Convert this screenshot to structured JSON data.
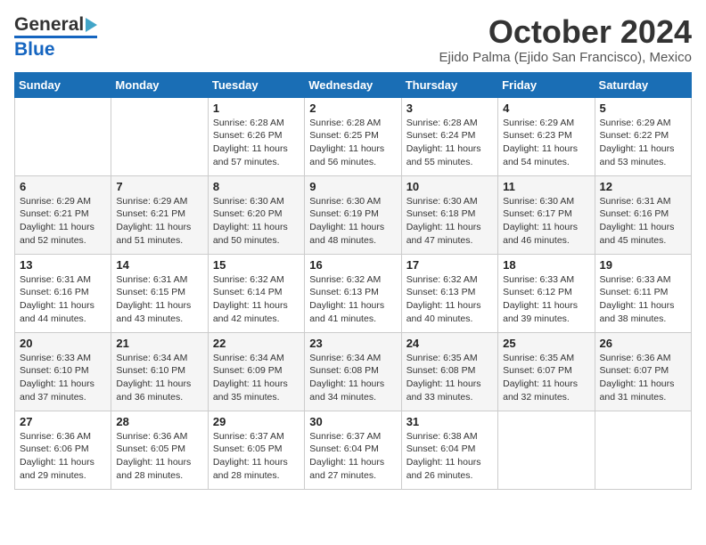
{
  "header": {
    "logo_general": "General",
    "logo_blue": "Blue",
    "month_title": "October 2024",
    "subtitle": "Ejido Palma (Ejido San Francisco), Mexico"
  },
  "days_of_week": [
    "Sunday",
    "Monday",
    "Tuesday",
    "Wednesday",
    "Thursday",
    "Friday",
    "Saturday"
  ],
  "weeks": [
    [
      {
        "num": "",
        "detail": ""
      },
      {
        "num": "",
        "detail": ""
      },
      {
        "num": "1",
        "detail": "Sunrise: 6:28 AM\nSunset: 6:26 PM\nDaylight: 11 hours and 57 minutes."
      },
      {
        "num": "2",
        "detail": "Sunrise: 6:28 AM\nSunset: 6:25 PM\nDaylight: 11 hours and 56 minutes."
      },
      {
        "num": "3",
        "detail": "Sunrise: 6:28 AM\nSunset: 6:24 PM\nDaylight: 11 hours and 55 minutes."
      },
      {
        "num": "4",
        "detail": "Sunrise: 6:29 AM\nSunset: 6:23 PM\nDaylight: 11 hours and 54 minutes."
      },
      {
        "num": "5",
        "detail": "Sunrise: 6:29 AM\nSunset: 6:22 PM\nDaylight: 11 hours and 53 minutes."
      }
    ],
    [
      {
        "num": "6",
        "detail": "Sunrise: 6:29 AM\nSunset: 6:21 PM\nDaylight: 11 hours and 52 minutes."
      },
      {
        "num": "7",
        "detail": "Sunrise: 6:29 AM\nSunset: 6:21 PM\nDaylight: 11 hours and 51 minutes."
      },
      {
        "num": "8",
        "detail": "Sunrise: 6:30 AM\nSunset: 6:20 PM\nDaylight: 11 hours and 50 minutes."
      },
      {
        "num": "9",
        "detail": "Sunrise: 6:30 AM\nSunset: 6:19 PM\nDaylight: 11 hours and 48 minutes."
      },
      {
        "num": "10",
        "detail": "Sunrise: 6:30 AM\nSunset: 6:18 PM\nDaylight: 11 hours and 47 minutes."
      },
      {
        "num": "11",
        "detail": "Sunrise: 6:30 AM\nSunset: 6:17 PM\nDaylight: 11 hours and 46 minutes."
      },
      {
        "num": "12",
        "detail": "Sunrise: 6:31 AM\nSunset: 6:16 PM\nDaylight: 11 hours and 45 minutes."
      }
    ],
    [
      {
        "num": "13",
        "detail": "Sunrise: 6:31 AM\nSunset: 6:16 PM\nDaylight: 11 hours and 44 minutes."
      },
      {
        "num": "14",
        "detail": "Sunrise: 6:31 AM\nSunset: 6:15 PM\nDaylight: 11 hours and 43 minutes."
      },
      {
        "num": "15",
        "detail": "Sunrise: 6:32 AM\nSunset: 6:14 PM\nDaylight: 11 hours and 42 minutes."
      },
      {
        "num": "16",
        "detail": "Sunrise: 6:32 AM\nSunset: 6:13 PM\nDaylight: 11 hours and 41 minutes."
      },
      {
        "num": "17",
        "detail": "Sunrise: 6:32 AM\nSunset: 6:13 PM\nDaylight: 11 hours and 40 minutes."
      },
      {
        "num": "18",
        "detail": "Sunrise: 6:33 AM\nSunset: 6:12 PM\nDaylight: 11 hours and 39 minutes."
      },
      {
        "num": "19",
        "detail": "Sunrise: 6:33 AM\nSunset: 6:11 PM\nDaylight: 11 hours and 38 minutes."
      }
    ],
    [
      {
        "num": "20",
        "detail": "Sunrise: 6:33 AM\nSunset: 6:10 PM\nDaylight: 11 hours and 37 minutes."
      },
      {
        "num": "21",
        "detail": "Sunrise: 6:34 AM\nSunset: 6:10 PM\nDaylight: 11 hours and 36 minutes."
      },
      {
        "num": "22",
        "detail": "Sunrise: 6:34 AM\nSunset: 6:09 PM\nDaylight: 11 hours and 35 minutes."
      },
      {
        "num": "23",
        "detail": "Sunrise: 6:34 AM\nSunset: 6:08 PM\nDaylight: 11 hours and 34 minutes."
      },
      {
        "num": "24",
        "detail": "Sunrise: 6:35 AM\nSunset: 6:08 PM\nDaylight: 11 hours and 33 minutes."
      },
      {
        "num": "25",
        "detail": "Sunrise: 6:35 AM\nSunset: 6:07 PM\nDaylight: 11 hours and 32 minutes."
      },
      {
        "num": "26",
        "detail": "Sunrise: 6:36 AM\nSunset: 6:07 PM\nDaylight: 11 hours and 31 minutes."
      }
    ],
    [
      {
        "num": "27",
        "detail": "Sunrise: 6:36 AM\nSunset: 6:06 PM\nDaylight: 11 hours and 29 minutes."
      },
      {
        "num": "28",
        "detail": "Sunrise: 6:36 AM\nSunset: 6:05 PM\nDaylight: 11 hours and 28 minutes."
      },
      {
        "num": "29",
        "detail": "Sunrise: 6:37 AM\nSunset: 6:05 PM\nDaylight: 11 hours and 28 minutes."
      },
      {
        "num": "30",
        "detail": "Sunrise: 6:37 AM\nSunset: 6:04 PM\nDaylight: 11 hours and 27 minutes."
      },
      {
        "num": "31",
        "detail": "Sunrise: 6:38 AM\nSunset: 6:04 PM\nDaylight: 11 hours and 26 minutes."
      },
      {
        "num": "",
        "detail": ""
      },
      {
        "num": "",
        "detail": ""
      }
    ]
  ]
}
